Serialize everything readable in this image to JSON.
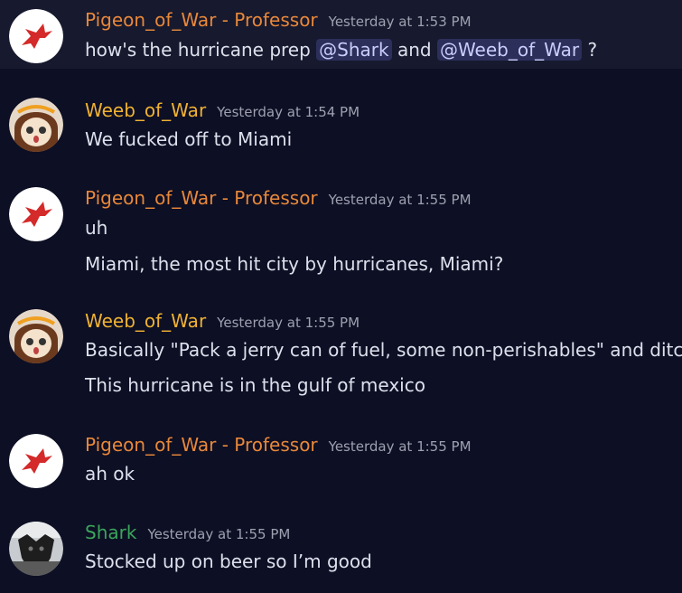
{
  "colors": {
    "background": "#0d0f24",
    "professor": "#e8883a",
    "weeb": "#f0b232",
    "shark": "#3ba55c",
    "mention_bg": "#2c2f5a"
  },
  "messages": [
    {
      "author": "Pigeon_of_War - Professor",
      "timestamp": "Yesterday at 1:53 PM",
      "avatar_icon": "pigeon-avatar-icon",
      "line1": {
        "text_a": "how's the hurricane prep ",
        "mention_a": "@Shark",
        "text_b": " and ",
        "mention_b": "@Weeb_of_War",
        "text_c": " ?"
      }
    },
    {
      "author": "Weeb_of_War",
      "timestamp": "Yesterday at 1:54 PM",
      "avatar_icon": "anime-girl-avatar-icon",
      "lines": [
        "We fucked off to Miami"
      ]
    },
    {
      "author": "Pigeon_of_War - Professor",
      "timestamp": "Yesterday at 1:55 PM",
      "avatar_icon": "pigeon-avatar-icon",
      "lines": [
        "uh",
        "Miami, the most hit city by hurricanes, Miami?"
      ]
    },
    {
      "author": "Weeb_of_War",
      "timestamp": "Yesterday at 1:55 PM",
      "avatar_icon": "anime-girl-avatar-icon",
      "lines": [
        "Basically \"Pack a jerry can of fuel, some non-perishables\" and ditch",
        "This hurricane is in the gulf of mexico"
      ]
    },
    {
      "author": "Pigeon_of_War - Professor",
      "timestamp": "Yesterday at 1:55 PM",
      "avatar_icon": "pigeon-avatar-icon",
      "lines": [
        "ah ok"
      ]
    },
    {
      "author": "Shark",
      "timestamp": "Yesterday at 1:55 PM",
      "avatar_icon": "dog-avatar-icon",
      "lines": [
        "Stocked up on beer so I’m good"
      ]
    }
  ]
}
